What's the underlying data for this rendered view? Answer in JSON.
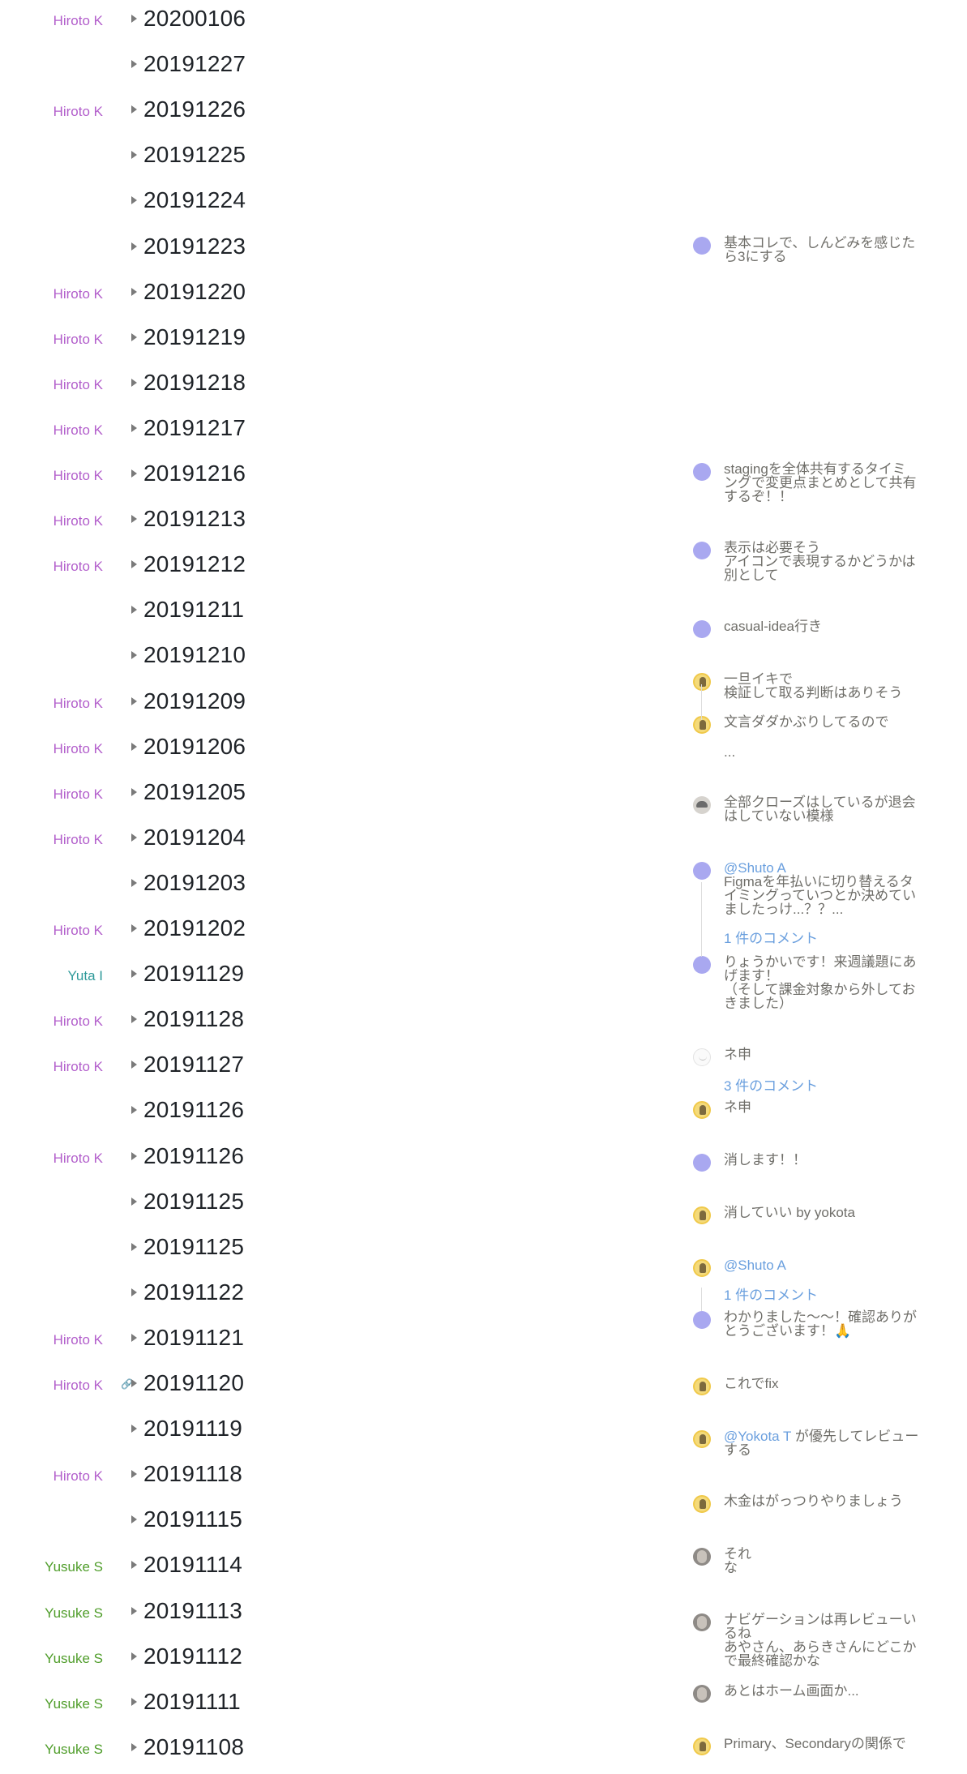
{
  "colors": {
    "author_hiroto": "#b25ecb",
    "author_yuta": "#2f9a9a",
    "author_yusuke": "#4f9d2a",
    "mention": "#6a9fde",
    "date_text": "#1f2328",
    "comment_text": "#6f6e69"
  },
  "rows": [
    {
      "author": "Hiroto K",
      "date": "20200106"
    },
    {
      "author": "",
      "date": "20191227"
    },
    {
      "author": "Hiroto K",
      "date": "20191226"
    },
    {
      "author": "",
      "date": "20191225"
    },
    {
      "author": "",
      "date": "20191224"
    },
    {
      "author": "",
      "date": "20191223"
    },
    {
      "author": "Hiroto K",
      "date": "20191220"
    },
    {
      "author": "Hiroto K",
      "date": "20191219"
    },
    {
      "author": "Hiroto K",
      "date": "20191218"
    },
    {
      "author": "Hiroto K",
      "date": "20191217"
    },
    {
      "author": "Hiroto K",
      "date": "20191216"
    },
    {
      "author": "Hiroto K",
      "date": "20191213"
    },
    {
      "author": "Hiroto K",
      "date": "20191212"
    },
    {
      "author": "",
      "date": "20191211"
    },
    {
      "author": "",
      "date": "20191210"
    },
    {
      "author": "Hiroto K",
      "date": "20191209"
    },
    {
      "author": "Hiroto K",
      "date": "20191206"
    },
    {
      "author": "Hiroto K",
      "date": "20191205"
    },
    {
      "author": "Hiroto K",
      "date": "20191204"
    },
    {
      "author": "",
      "date": "20191203"
    },
    {
      "author": "Hiroto K",
      "date": "20191202"
    },
    {
      "author": "Yuta I",
      "date": "20191129"
    },
    {
      "author": "Hiroto K",
      "date": "20191128"
    },
    {
      "author": "Hiroto K",
      "date": "20191127"
    },
    {
      "author": "",
      "date": "20191126"
    },
    {
      "author": "Hiroto K",
      "date": "20191126"
    },
    {
      "author": "",
      "date": "20191125"
    },
    {
      "author": "",
      "date": "20191125"
    },
    {
      "author": "",
      "date": "20191122"
    },
    {
      "author": "Hiroto K",
      "date": "20191121"
    },
    {
      "author": "Hiroto K",
      "date": "20191120",
      "link": true
    },
    {
      "author": "",
      "date": "20191119"
    },
    {
      "author": "Hiroto K",
      "date": "20191118"
    },
    {
      "author": "",
      "date": "20191115"
    },
    {
      "author": "Yusuke S",
      "date": "20191114"
    },
    {
      "author": "Yusuke S",
      "date": "20191113"
    },
    {
      "author": "Yusuke S",
      "date": "20191112"
    },
    {
      "author": "Yusuke S",
      "date": "20191111"
    },
    {
      "author": "Yusuke S",
      "date": "20191108"
    }
  ],
  "comments": [
    {
      "avatar": "purple",
      "text": "基本コレで、しんどみを感じた\nら3にする"
    },
    {
      "avatar": "purple",
      "text": "stagingを全体共有するタイミ\nングで変更点まとめとして共有\nするぞ！！"
    },
    {
      "avatar": "purple",
      "text": "表示は必要そう\nアイコンで表現するかどうかは\n別として"
    },
    {
      "avatar": "purple",
      "text": "casual-idea行き"
    },
    {
      "avatar": "yellow",
      "text": "一旦イキで\n検証して取る判断はありそう"
    },
    {
      "avatar": "yellow",
      "text": "文言ダダかぶりしてるので"
    },
    {
      "avatar": "",
      "text": "..."
    },
    {
      "avatar": "gray",
      "text": "全部クローズはしているが退会\nはしていない模様"
    },
    {
      "avatar": "purple",
      "mention": "@Shuto A",
      "text": "Figmaを年払いに切り替えるタ\nイミングっていつとか決めてい\nましたっけ...？？..."
    },
    {
      "count": "1 件のコメント"
    },
    {
      "avatar": "purple",
      "text": "りょうかいです！来週議題にあ\nげます！\n（そして課金対象から外してお\nきました）"
    },
    {
      "avatar": "white",
      "text": "ネ申"
    },
    {
      "count": "3 件のコメント"
    },
    {
      "avatar": "yellow",
      "text": "ネ申"
    },
    {
      "avatar": "purple",
      "text": "消します！！"
    },
    {
      "avatar": "yellow",
      "text": "消していい by yokota"
    },
    {
      "avatar": "yellow",
      "mention": "@Shuto A",
      "text": ""
    },
    {
      "count": "1 件のコメント"
    },
    {
      "avatar": "purple",
      "text": "わかりました〜〜！確認ありが\nとうございます！🙏"
    },
    {
      "avatar": "yellow",
      "text": "これでfix"
    },
    {
      "avatar": "yellow",
      "mention": "@Yokota T",
      "text": " が優先してレビュー\nする"
    },
    {
      "avatar": "yellow",
      "text": "木金はがっつりやりましょう"
    },
    {
      "avatar": "photo",
      "text": "それ\nな"
    },
    {
      "avatar": "photo",
      "text": "ナビゲーションは再レビューい\nるね\nあやさん、あらきさんにどこか\nで最終確認かな"
    },
    {
      "avatar": "photo",
      "text": "あとはホーム画面か..."
    },
    {
      "avatar": "yellow",
      "text": "Primary、Secondaryの関係で"
    }
  ]
}
